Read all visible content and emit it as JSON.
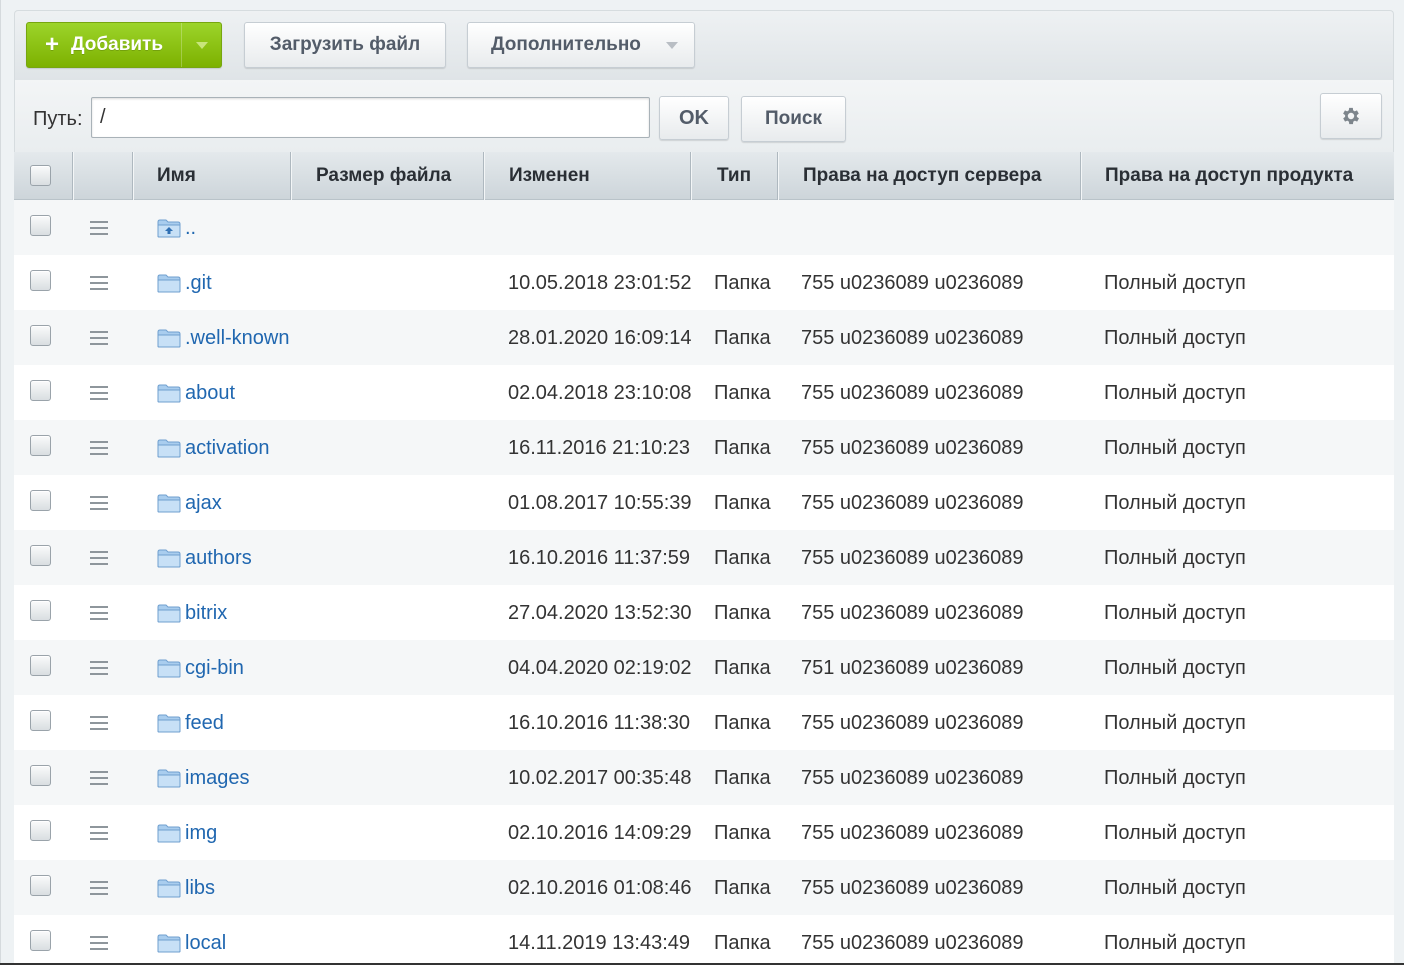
{
  "toolbar": {
    "add_label": "Добавить",
    "upload_label": "Загрузить файл",
    "more_label": "Дополнительно"
  },
  "path": {
    "label": "Путь:",
    "value": "/",
    "ok_label": "OK",
    "search_label": "Поиск"
  },
  "columns": {
    "name": "Имя",
    "size": "Размер файла",
    "modified": "Изменен",
    "type": "Тип",
    "server_rights": "Права на доступ сервера",
    "product_rights": "Права на доступ продукта"
  },
  "rows": [
    {
      "name": "..",
      "modified": "",
      "type": "",
      "server_rights": "",
      "product_rights": "",
      "icon": "folder-up-icon"
    },
    {
      "name": ".git",
      "modified": "10.05.2018 23:01:52",
      "type": "Папка",
      "server_rights": "755 u0236089 u0236089",
      "product_rights": "Полный доступ",
      "icon": "folder-icon"
    },
    {
      "name": ".well-known",
      "modified": "28.01.2020 16:09:14",
      "type": "Папка",
      "server_rights": "755 u0236089 u0236089",
      "product_rights": "Полный доступ",
      "icon": "folder-icon"
    },
    {
      "name": "about",
      "modified": "02.04.2018 23:10:08",
      "type": "Папка",
      "server_rights": "755 u0236089 u0236089",
      "product_rights": "Полный доступ",
      "icon": "folder-icon"
    },
    {
      "name": "activation",
      "modified": "16.11.2016 21:10:23",
      "type": "Папка",
      "server_rights": "755 u0236089 u0236089",
      "product_rights": "Полный доступ",
      "icon": "folder-icon"
    },
    {
      "name": "ajax",
      "modified": "01.08.2017 10:55:39",
      "type": "Папка",
      "server_rights": "755 u0236089 u0236089",
      "product_rights": "Полный доступ",
      "icon": "folder-icon"
    },
    {
      "name": "authors",
      "modified": "16.10.2016 11:37:59",
      "type": "Папка",
      "server_rights": "755 u0236089 u0236089",
      "product_rights": "Полный доступ",
      "icon": "folder-icon"
    },
    {
      "name": "bitrix",
      "modified": "27.04.2020 13:52:30",
      "type": "Папка",
      "server_rights": "755 u0236089 u0236089",
      "product_rights": "Полный доступ",
      "icon": "folder-icon"
    },
    {
      "name": "cgi-bin",
      "modified": "04.04.2020 02:19:02",
      "type": "Папка",
      "server_rights": "751 u0236089 u0236089",
      "product_rights": "Полный доступ",
      "icon": "folder-icon"
    },
    {
      "name": "feed",
      "modified": "16.10.2016 11:38:30",
      "type": "Папка",
      "server_rights": "755 u0236089 u0236089",
      "product_rights": "Полный доступ",
      "icon": "folder-icon"
    },
    {
      "name": "images",
      "modified": "10.02.2017 00:35:48",
      "type": "Папка",
      "server_rights": "755 u0236089 u0236089",
      "product_rights": "Полный доступ",
      "icon": "folder-icon"
    },
    {
      "name": "img",
      "modified": "02.10.2016 14:09:29",
      "type": "Папка",
      "server_rights": "755 u0236089 u0236089",
      "product_rights": "Полный доступ",
      "icon": "folder-icon"
    },
    {
      "name": "libs",
      "modified": "02.10.2016 01:08:46",
      "type": "Папка",
      "server_rights": "755 u0236089 u0236089",
      "product_rights": "Полный доступ",
      "icon": "folder-icon"
    },
    {
      "name": "local",
      "modified": "14.11.2019 13:43:49",
      "type": "Папка",
      "server_rights": "755 u0236089 u0236089",
      "product_rights": "Полный доступ",
      "icon": "folder-icon"
    }
  ]
}
